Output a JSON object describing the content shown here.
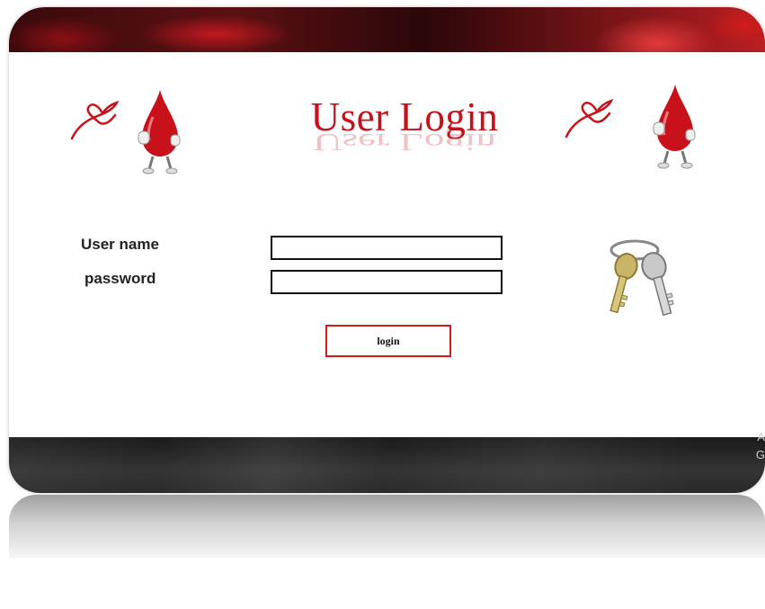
{
  "header": {
    "title": "User Login"
  },
  "form": {
    "username_label": "User name",
    "username_value": "",
    "password_label": "password",
    "password_value": "",
    "submit_label": "login"
  },
  "footer": {
    "line1": "A",
    "line2": "G"
  },
  "icons": [
    "ribbon-heart-icon",
    "blood-drop-mascot-icon",
    "keys-icon"
  ],
  "colors": {
    "accent": "#c8111b",
    "button_border": "#d11a1a",
    "footer_bg": "#2a2a2a"
  }
}
